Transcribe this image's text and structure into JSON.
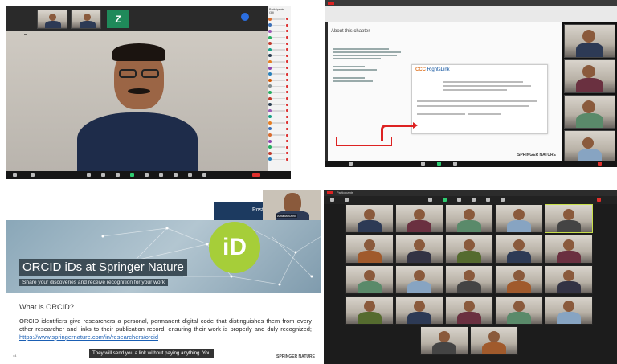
{
  "quad1": {
    "strip_tile_letter": "Z",
    "main_speaker_name": "",
    "panel_title": "Participants (39)",
    "participants": [
      {
        "color": "#d86b2d"
      },
      {
        "color": "#3b6fb6"
      },
      {
        "color": "#9b59b6"
      },
      {
        "color": "#27ae60"
      },
      {
        "color": "#c0392b"
      },
      {
        "color": "#16a085"
      },
      {
        "color": "#2c3e50"
      },
      {
        "color": "#e67e22"
      },
      {
        "color": "#8e44ad"
      },
      {
        "color": "#2980b9"
      },
      {
        "color": "#d35400"
      },
      {
        "color": "#7f8c8d"
      },
      {
        "color": "#27ae60"
      },
      {
        "color": "#c0392b"
      },
      {
        "color": "#2c3e50"
      },
      {
        "color": "#9b59b6"
      },
      {
        "color": "#16a085"
      },
      {
        "color": "#e67e22"
      },
      {
        "color": "#3b6fb6"
      },
      {
        "color": "#d86b2d"
      },
      {
        "color": "#8e44ad"
      },
      {
        "color": "#27ae60"
      },
      {
        "color": "#c0392b"
      },
      {
        "color": "#2980b9"
      }
    ],
    "leave_label": ""
  },
  "quad2": {
    "heading": "About this chapter",
    "rights_logo_a": "CCC",
    "rights_logo_b": "RightsLink",
    "publisher": "SPRINGER NATURE"
  },
  "quad3": {
    "header_text": "Post-Pu",
    "cam_name": "Amada Saini",
    "orcid_logo": "iD",
    "title": "ORCID iDs at Springer Nature",
    "subtitle": "Share your discoveries and receive recognition for your work",
    "what_heading": "What is ORCID?",
    "body_before_link": "ORCID identifiers give researchers a personal, permanent digital code that distinguishes them from every other researcher and links to their publication record, ensuring their work is properly and duly recognized; ",
    "body_link": "https://www.springernature.com/in/researchers/orcid",
    "caption": "They will send you a link without paying anything. You",
    "page_number": "44",
    "brand": "SPRINGER NATURE"
  },
  "quad4": {
    "window_title": "Participants"
  },
  "colors": {
    "orcid_green": "#a6ce39",
    "zoom_red": "#e0302c",
    "active_speaker": "#c8e04a"
  }
}
